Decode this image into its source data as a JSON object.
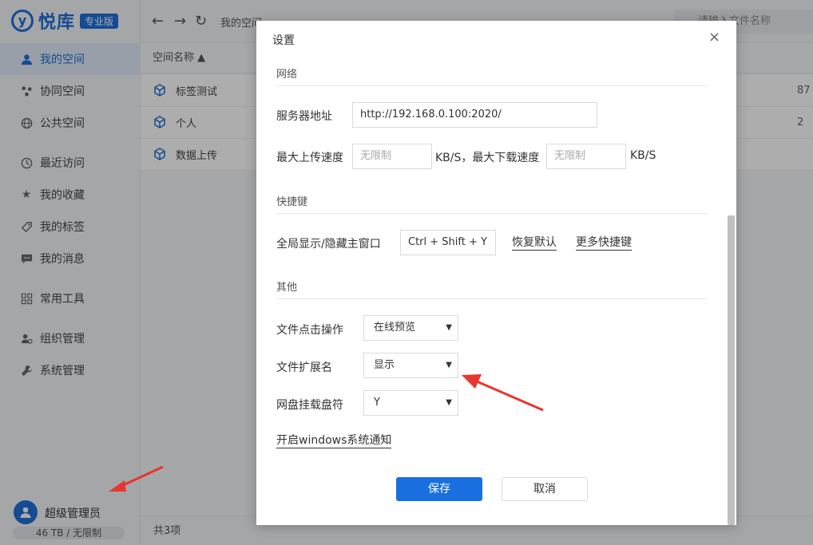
{
  "app": {
    "logo_text": "悦库",
    "edition_badge": "专业版",
    "breadcrumb": "我的空间",
    "search_placeholder": "请输入文件名称"
  },
  "sidebar": {
    "items": [
      {
        "label": "我的空间",
        "icon": "user-icon",
        "active": true
      },
      {
        "label": "协同空间",
        "icon": "collaborate-icon"
      },
      {
        "label": "公共空间",
        "icon": "globe-icon"
      },
      {
        "label": "最近访问",
        "icon": "clock-icon"
      },
      {
        "label": "我的收藏",
        "icon": "star-icon"
      },
      {
        "label": "我的标签",
        "icon": "tag-icon"
      },
      {
        "label": "我的消息",
        "icon": "message-icon"
      },
      {
        "label": "常用工具",
        "icon": "grid-icon"
      },
      {
        "label": "组织管理",
        "icon": "org-icon"
      },
      {
        "label": "系统管理",
        "icon": "wrench-icon"
      }
    ],
    "user": {
      "name": "超级管理员",
      "quota": "46 TB / 无限制"
    }
  },
  "list": {
    "header": "空间名称 ▲",
    "rows": [
      {
        "name": "标签测试",
        "size": "87"
      },
      {
        "name": "个人",
        "size": "2"
      },
      {
        "name": "数据上传",
        "size": ""
      }
    ],
    "count": "共3项"
  },
  "modal": {
    "title": "设置",
    "close": "×",
    "network": {
      "title": "网络",
      "server_label": "服务器地址",
      "server_value": "http://192.168.0.100:2020/",
      "upload_label": "最大上传速度",
      "upload_placeholder": "无限制",
      "unit_kbs_comma": "KB/S，最大下载速度",
      "download_placeholder": "无限制",
      "unit_kbs": "KB/S"
    },
    "shortcuts": {
      "title": "快捷键",
      "toggle_label": "全局显示/隐藏主窗口",
      "toggle_value": "Ctrl + Shift + Y",
      "restore_default": "恢复默认",
      "more_shortcuts": "更多快捷键"
    },
    "other": {
      "title": "其他",
      "click_label": "文件点击操作",
      "click_value": "在线预览",
      "ext_label": "文件扩展名",
      "ext_value": "显示",
      "drive_label": "网盘挂载盘符",
      "drive_value": "Y",
      "windows_notify": "开启windows系统通知"
    },
    "save": "保存",
    "cancel": "取消"
  },
  "colors": {
    "accent": "#1e6fd9",
    "arrow": "#e8352e"
  }
}
